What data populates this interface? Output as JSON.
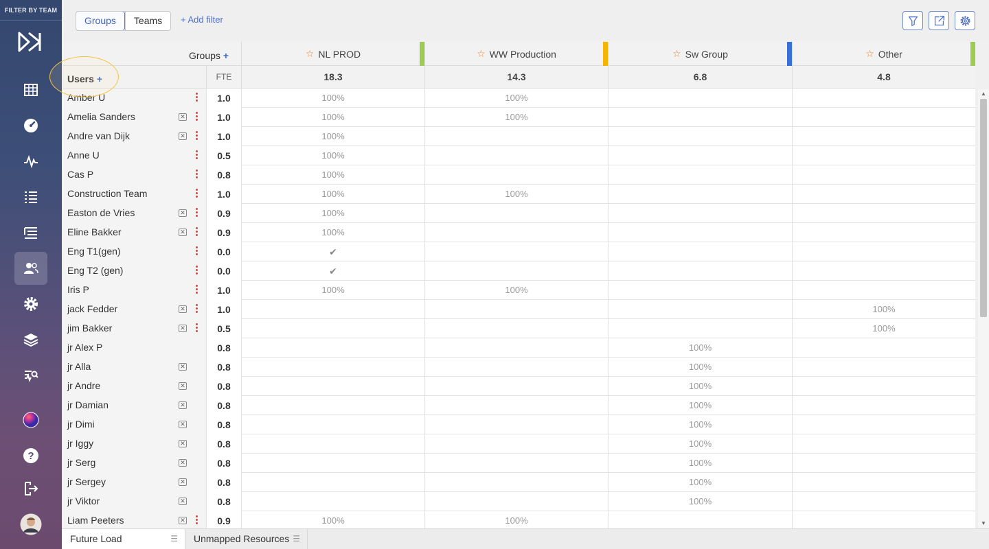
{
  "sidebar": {
    "filter_label": "FILTER BY TEAM",
    "icons": [
      "logo-icon",
      "grid-icon",
      "dashboard-icon",
      "activity-icon",
      "list-icon",
      "tree-list-icon",
      "users-icon",
      "settings-icon",
      "layers-icon",
      "analytics-icon",
      "sphere-icon",
      "help-icon",
      "logout-icon",
      "avatar"
    ],
    "active": "users-icon"
  },
  "toolbar": {
    "groups_tab": "Groups",
    "teams_tab": "Teams",
    "add_filter": "+ Add filter",
    "buttons": [
      "filter-icon",
      "export-icon",
      "settings-icon"
    ]
  },
  "header": {
    "groups_label": "Groups",
    "users_label": "Users",
    "plus": "+",
    "fte_label": "FTE"
  },
  "groups": [
    {
      "name": "NL PROD",
      "total": "18.3",
      "color": "#9ccc50"
    },
    {
      "name": "WW Production",
      "total": "14.3",
      "color": "#f4b400"
    },
    {
      "name": "Sw Group",
      "total": "6.8",
      "color": "#3a6fd8"
    },
    {
      "name": "Other",
      "total": "4.8",
      "color": "#9ccc50"
    }
  ],
  "rows": [
    {
      "name": "Amber U",
      "x": false,
      "menu": true,
      "fte": "1.0",
      "cells": [
        "100%",
        "100%",
        "",
        ""
      ]
    },
    {
      "name": "Amelia Sanders",
      "x": true,
      "menu": true,
      "fte": "1.0",
      "cells": [
        "100%",
        "100%",
        "",
        ""
      ]
    },
    {
      "name": "Andre van Dijk",
      "x": true,
      "menu": true,
      "fte": "1.0",
      "cells": [
        "100%",
        "",
        "",
        ""
      ]
    },
    {
      "name": "Anne U",
      "x": false,
      "menu": true,
      "fte": "0.5",
      "cells": [
        "100%",
        "",
        "",
        ""
      ]
    },
    {
      "name": "Cas P",
      "x": false,
      "menu": true,
      "fte": "0.8",
      "cells": [
        "100%",
        "",
        "",
        ""
      ]
    },
    {
      "name": "Construction Team",
      "x": false,
      "menu": true,
      "fte": "1.0",
      "cells": [
        "100%",
        "100%",
        "",
        ""
      ]
    },
    {
      "name": "Easton de Vries",
      "x": true,
      "menu": true,
      "fte": "0.9",
      "cells": [
        "100%",
        "",
        "",
        ""
      ]
    },
    {
      "name": "Eline Bakker",
      "x": true,
      "menu": true,
      "fte": "0.9",
      "cells": [
        "100%",
        "",
        "",
        ""
      ]
    },
    {
      "name": "Eng T1(gen)",
      "x": false,
      "menu": true,
      "fte": "0.0",
      "cells": [
        "✔",
        "",
        "",
        ""
      ]
    },
    {
      "name": "Eng T2 (gen)",
      "x": false,
      "menu": true,
      "fte": "0.0",
      "cells": [
        "✔",
        "",
        "",
        ""
      ]
    },
    {
      "name": "Iris P",
      "x": false,
      "menu": true,
      "fte": "1.0",
      "cells": [
        "100%",
        "100%",
        "",
        ""
      ]
    },
    {
      "name": "jack Fedder",
      "x": true,
      "menu": true,
      "fte": "1.0",
      "cells": [
        "",
        "",
        "",
        "100%"
      ]
    },
    {
      "name": "jim Bakker",
      "x": true,
      "menu": true,
      "fte": "0.5",
      "cells": [
        "",
        "",
        "",
        "100%"
      ]
    },
    {
      "name": "jr Alex P",
      "x": false,
      "menu": false,
      "fte": "0.8",
      "cells": [
        "",
        "",
        "100%",
        ""
      ]
    },
    {
      "name": "jr Alla",
      "x": true,
      "menu": false,
      "fte": "0.8",
      "cells": [
        "",
        "",
        "100%",
        ""
      ]
    },
    {
      "name": "jr Andre",
      "x": true,
      "menu": false,
      "fte": "0.8",
      "cells": [
        "",
        "",
        "100%",
        ""
      ]
    },
    {
      "name": "jr Damian",
      "x": true,
      "menu": false,
      "fte": "0.8",
      "cells": [
        "",
        "",
        "100%",
        ""
      ]
    },
    {
      "name": "jr Dimi",
      "x": true,
      "menu": false,
      "fte": "0.8",
      "cells": [
        "",
        "",
        "100%",
        ""
      ]
    },
    {
      "name": "jr Iggy",
      "x": true,
      "menu": false,
      "fte": "0.8",
      "cells": [
        "",
        "",
        "100%",
        ""
      ]
    },
    {
      "name": "jr Serg",
      "x": true,
      "menu": false,
      "fte": "0.8",
      "cells": [
        "",
        "",
        "100%",
        ""
      ]
    },
    {
      "name": "jr Sergey",
      "x": true,
      "menu": false,
      "fte": "0.8",
      "cells": [
        "",
        "",
        "100%",
        ""
      ]
    },
    {
      "name": "jr Viktor",
      "x": true,
      "menu": false,
      "fte": "0.8",
      "cells": [
        "",
        "",
        "100%",
        ""
      ]
    },
    {
      "name": "Liam Peeters",
      "x": true,
      "menu": true,
      "fte": "0.9",
      "cells": [
        "100%",
        "100%",
        "",
        ""
      ]
    }
  ],
  "bottom_tabs": [
    "Future Load",
    "Unmapped Resources"
  ]
}
